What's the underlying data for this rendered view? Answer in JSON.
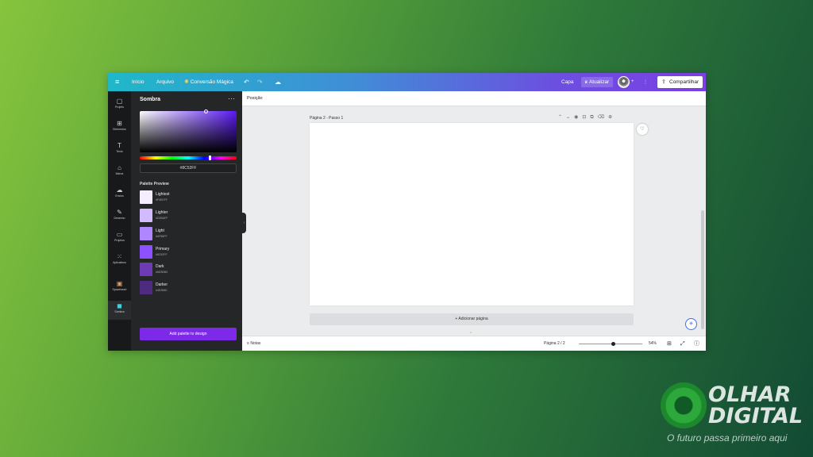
{
  "topbar": {
    "menu_icon": "hamburger-icon",
    "home": "Início",
    "file": "Arquivo",
    "magic": "Conversão Mágica",
    "cover": "Capa",
    "update": "Atualizar",
    "share": "Compartilhar"
  },
  "rail": [
    {
      "icon": "layout-icon",
      "glyph": "▢",
      "label": "Projeto"
    },
    {
      "icon": "elements-icon",
      "glyph": "⊞",
      "label": "Elementos"
    },
    {
      "icon": "text-icon",
      "glyph": "T",
      "label": "Texto"
    },
    {
      "icon": "brand-icon",
      "glyph": "⌂",
      "label": "Marca"
    },
    {
      "icon": "uploads-icon",
      "glyph": "☁",
      "label": "Envios"
    },
    {
      "icon": "draw-icon",
      "glyph": "✎",
      "label": "Desenho"
    },
    {
      "icon": "projects-icon",
      "glyph": "▭",
      "label": "Projetos"
    },
    {
      "icon": "apps-icon",
      "glyph": "⋮",
      "label": "Aplicativos"
    },
    {
      "icon": "spaceheart-icon",
      "glyph": "▣",
      "label": "Spaceheart"
    },
    {
      "icon": "sombra-icon",
      "glyph": "◼",
      "label": "Sombra"
    }
  ],
  "panel": {
    "title": "Sombra",
    "hex": "#8C52FF",
    "palette_title": "Palette Preview",
    "swatches": [
      {
        "name": "Lightest",
        "hex": "#F4EEFF",
        "color": "#f4eeff"
      },
      {
        "name": "Lighter",
        "hex": "#D2BAFF",
        "color": "#d2baff"
      },
      {
        "name": "Light",
        "hex": "#AF86FF",
        "color": "#af86ff"
      },
      {
        "name": "Primary",
        "hex": "#8C52FF",
        "color": "#8c52ff"
      },
      {
        "name": "Dark",
        "hex": "#6D3BB3",
        "color": "#6d3bb3"
      },
      {
        "name": "Darker",
        "hex": "#4E2B80",
        "color": "#4e2b80"
      }
    ],
    "add_button": "Add palette to design"
  },
  "main": {
    "context": "Posição",
    "page_label": "Página 2 - Passo 1",
    "add_page": "+ Adicionar página"
  },
  "bottom": {
    "notes": "Notas",
    "pages": "Página 2 / 2",
    "zoom": "54%",
    "zoom_level": 0.54
  },
  "watermark": {
    "brand_line1": "OLHAR",
    "brand_line2": "DIGITAL",
    "tagline": "O futuro passa primeiro aqui"
  },
  "colors": {
    "accent": "#7d2ae8",
    "panel_bg": "#252627"
  }
}
